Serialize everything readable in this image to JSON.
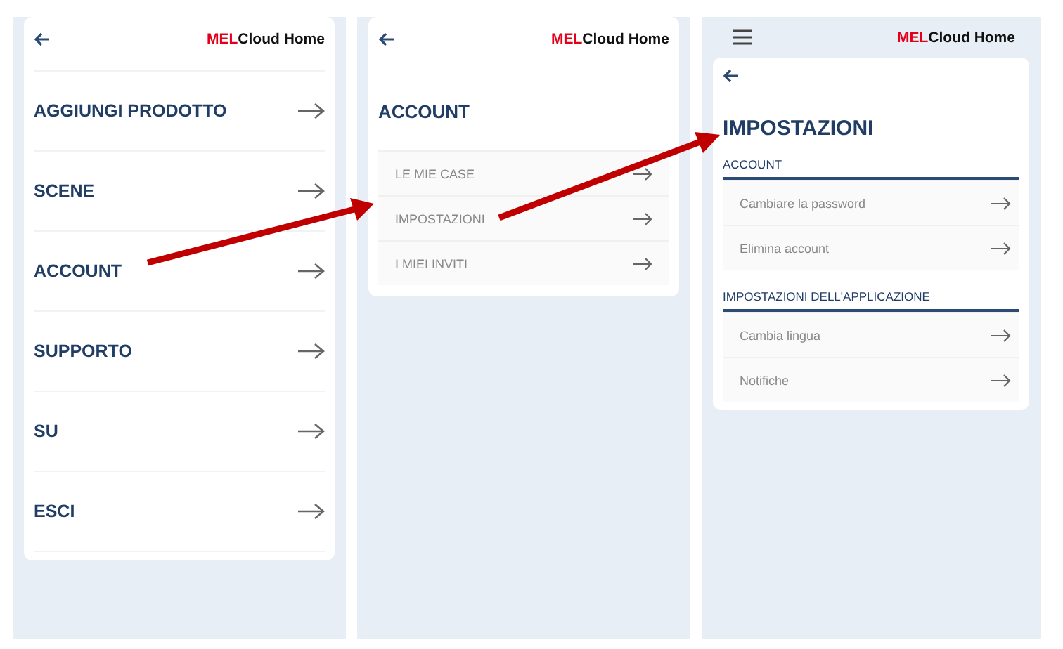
{
  "screens": [
    {
      "kind": "menu",
      "logo": {
        "brand": "MEL",
        "product": "Cloud Home"
      },
      "items": [
        {
          "label": "AGGIUNGI PRODOTTO"
        },
        {
          "label": "SCENE"
        },
        {
          "label": "ACCOUNT"
        },
        {
          "label": "SUPPORTO"
        },
        {
          "label": "SU"
        },
        {
          "label": "ESCI"
        }
      ]
    },
    {
      "kind": "submenu",
      "logo": {
        "brand": "MEL",
        "product": "Cloud Home"
      },
      "title": "ACCOUNT",
      "items": [
        {
          "label": "LE MIE CASE"
        },
        {
          "label": "IMPOSTAZIONI"
        },
        {
          "label": "I MIEI INVITI"
        }
      ]
    },
    {
      "kind": "settings",
      "logo": {
        "brand": "MEL",
        "product": "Cloud Home"
      },
      "title": "IMPOSTAZIONI",
      "sections": [
        {
          "heading": "ACCOUNT",
          "items": [
            {
              "label": "Cambiare la password"
            },
            {
              "label": "Elimina account"
            }
          ]
        },
        {
          "heading": "IMPOSTAZIONI DELL'APPLICAZIONE",
          "items": [
            {
              "label": "Cambia lingua"
            },
            {
              "label": "Notifiche"
            }
          ]
        }
      ]
    }
  ],
  "annotations": [
    {
      "kind": "arrow"
    },
    {
      "kind": "arrow"
    }
  ]
}
